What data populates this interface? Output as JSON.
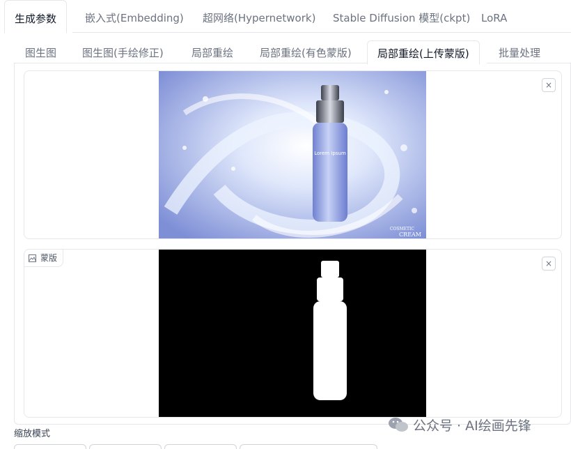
{
  "top_tabs": [
    {
      "label": "生成参数",
      "active": true
    },
    {
      "label": "嵌入式(Embedding)"
    },
    {
      "label": "超网络(Hypernetwork)"
    },
    {
      "label": "Stable Diffusion 模型(ckpt)"
    },
    {
      "label": "LoRA"
    }
  ],
  "sub_tabs": [
    {
      "label": "图生图"
    },
    {
      "label": "图生图(手绘修正)"
    },
    {
      "label": "局部重绘"
    },
    {
      "label": "局部重绘(有色蒙版)"
    },
    {
      "label": "局部重绘(上传蒙版)",
      "active": true
    },
    {
      "label": "批量处理"
    }
  ],
  "source_image": {
    "bottle_label": "Lorem Ipsum",
    "corner_text_1": "COSMETIC",
    "corner_text_2": "CREAM",
    "close_label": "×",
    "colors": {
      "background": "#a9b8f0",
      "swirl": "#e8f1ff",
      "bottle": "#8fa1e5"
    }
  },
  "mask_image": {
    "label": "蒙版",
    "close_label": "×",
    "colors": {
      "background": "#000000",
      "mask": "#ffffff"
    }
  },
  "scale_mode_label": "缩放模式",
  "watermark": "公众号 · AI绘画先锋"
}
